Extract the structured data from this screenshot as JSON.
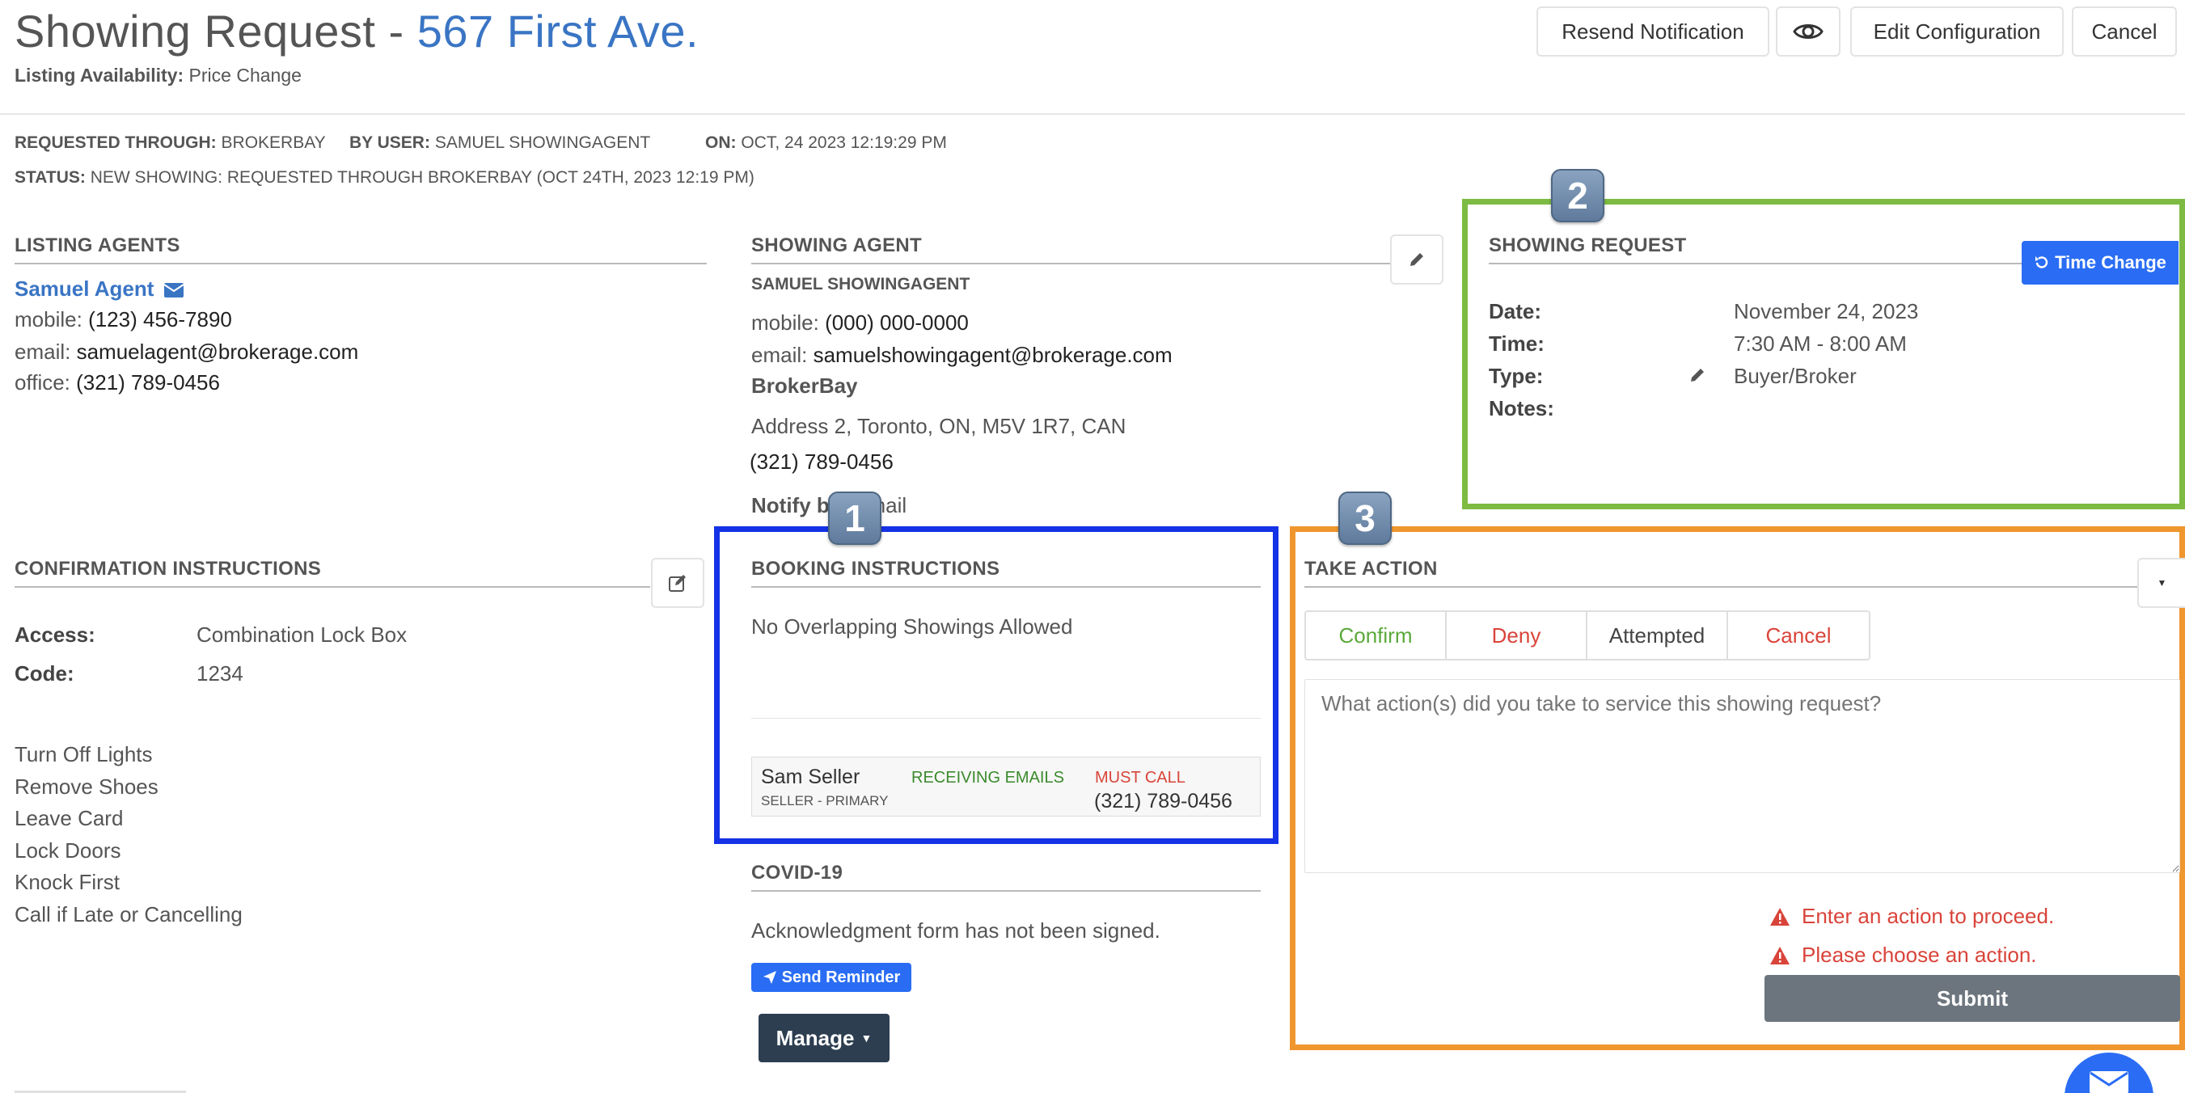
{
  "header": {
    "title_prefix": "Showing Request - ",
    "title_address": "567 First Ave.",
    "availability_label": "Listing Availability:",
    "availability_value": "Price Change",
    "buttons": {
      "resend": "Resend Notification",
      "preview_icon": "eye-icon",
      "edit": "Edit Configuration",
      "cancel": "Cancel"
    }
  },
  "meta": {
    "requested_through_label": "REQUESTED THROUGH:",
    "requested_through_value": "BROKERBAY",
    "by_user_label": "BY USER:",
    "by_user_value": "SAMUEL SHOWINGAGENT",
    "on_label": "ON:",
    "on_value": "OCT, 24 2023 12:19:29 PM",
    "status_label": "STATUS:",
    "status_value": "NEW SHOWING: REQUESTED THROUGH BROKERBAY (OCT 24TH, 2023 12:19 PM)"
  },
  "listing_agents": {
    "heading": "LISTING AGENTS",
    "name": "Samuel Agent",
    "mobile_label": "mobile:",
    "mobile": "(123) 456-7890",
    "email_label": "email:",
    "email": "samuelagent@brokerage.com",
    "office_label": "office:",
    "office": "(321) 789-0456"
  },
  "showing_agent": {
    "heading": "SHOWING AGENT",
    "name": "SAMUEL SHOWINGAGENT",
    "mobile_label": "mobile:",
    "mobile": "(000) 000-0000",
    "email_label": "email:",
    "email": "samuelshowingagent@brokerage.com",
    "brokerage": "BrokerBay",
    "address": "Address 2, Toronto, ON, M5V 1R7, CAN",
    "phone": "(321) 789-0456",
    "notify_label": "Notify by:",
    "notify_value": "Email"
  },
  "showing_request": {
    "heading": "SHOWING REQUEST",
    "time_change_button": "Time Change",
    "date_label": "Date:",
    "date": "November 24, 2023",
    "time_label": "Time:",
    "time": "7:30 AM - 8:00 AM",
    "type_label": "Type:",
    "type": "Buyer/Broker",
    "notes_label": "Notes:"
  },
  "confirmation": {
    "heading": "CONFIRMATION INSTRUCTIONS",
    "access_label": "Access:",
    "access": "Combination Lock Box",
    "code_label": "Code:",
    "code": "1234",
    "instructions": [
      "Turn Off Lights",
      "Remove Shoes",
      "Leave Card",
      "Lock Doors",
      "Knock First",
      "Call if Late or Cancelling"
    ]
  },
  "booking": {
    "heading": "BOOKING INSTRUCTIONS",
    "text": "No Overlapping Showings Allowed",
    "seller_name": "Sam Seller",
    "seller_role": "SELLER - PRIMARY",
    "seller_email_status": "RECEIVING EMAILS",
    "seller_call_status": "MUST CALL",
    "seller_phone": "(321) 789-0456"
  },
  "covid": {
    "heading": "COVID-19",
    "text": "Acknowledgment form has not been signed.",
    "reminder_button": "Send Reminder",
    "manage_button": "Manage"
  },
  "take_action": {
    "heading": "TAKE ACTION",
    "tabs": [
      "Confirm",
      "Deny",
      "Attempted",
      "Cancel"
    ],
    "textarea_placeholder": "What action(s) did you take to service this showing request?",
    "error1": "Enter an action to proceed.",
    "error2": "Please choose an action.",
    "submit": "Submit"
  },
  "annotations": {
    "badge1": "1",
    "badge2": "2",
    "badge3": "3",
    "colors": {
      "blue": "#1432e6",
      "green": "#7dbb42",
      "orange": "#f0962e"
    }
  }
}
